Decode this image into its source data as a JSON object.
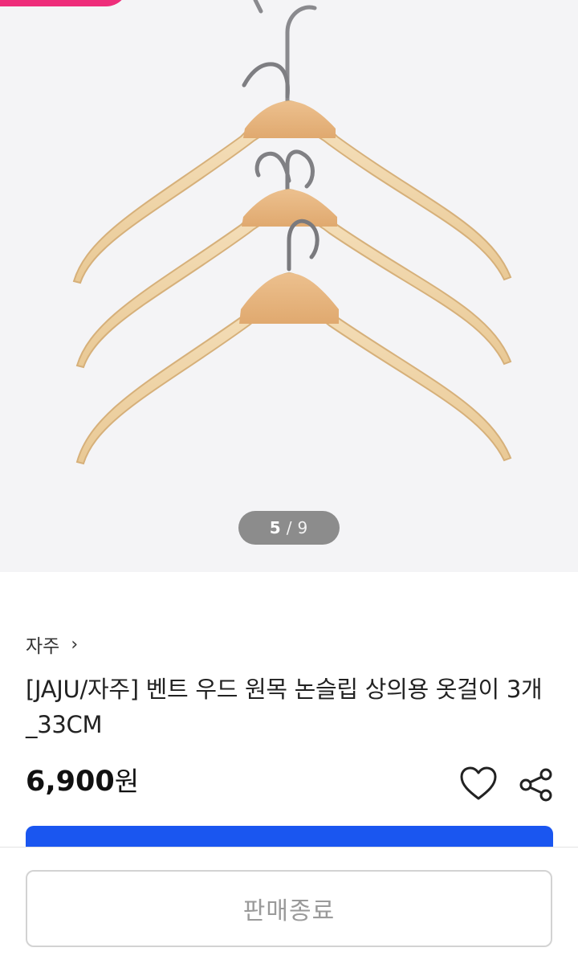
{
  "gallery": {
    "current": "5",
    "separator": "/",
    "total": "9"
  },
  "product": {
    "brand": "자주",
    "brand_chevron": "›",
    "title": "[JAJU/자주] 벤트 우드 원목 논슬립 상의용 옷걸이 3개_33CM",
    "price_value": "6,900",
    "price_unit": "원"
  },
  "actions": {
    "heart_icon": "heart-outline-icon",
    "share_icon": "share-icon",
    "soldout_label": "판매종료"
  },
  "colors": {
    "promo_tab": "#ee2d7a",
    "primary_blue": "#1a56f0",
    "disabled_text": "#9a9a9a"
  }
}
